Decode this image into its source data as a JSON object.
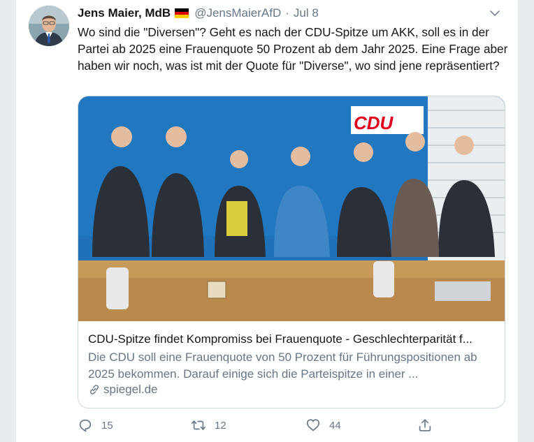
{
  "tweet": {
    "author_name": "Jens Maier, MdB",
    "author_handle": "@JensMaierAfD",
    "separator": "·",
    "date": "Jul 8",
    "flag": "germany-flag",
    "text": "Wo sind die \"Diversen\"? Geht es nach der CDU-Spitze um AKK, soll es in der Partei ab 2025 eine Frauenquote 50 Prozent ab dem Jahr 2025. Eine Frage aber haben wir noch, was ist mit der Quote für \"Diverse\", wo sind jene repräsentiert?"
  },
  "link_card": {
    "image_sign_text": "CDU",
    "title": "CDU-Spitze findet Kompromiss bei Frauenquote - Geschlechterparität f...",
    "description": "Die CDU soll eine Frauenquote von 50 Prozent für Führungspositionen ab 2025 bekommen. Darauf einige sich die Parteispitze in einer ...",
    "domain": "spiegel.de"
  },
  "actions": {
    "reply_count": "15",
    "retweet_count": "12",
    "like_count": "44"
  },
  "icons": {
    "reply": "reply-icon",
    "retweet": "retweet-icon",
    "like": "heart-icon",
    "share": "share-icon",
    "caret": "chevron-down-icon",
    "link": "link-icon"
  },
  "colors": {
    "text_primary": "#14171a",
    "text_secondary": "#657786",
    "border": "#ccd6dd",
    "background_gutter": "#e6ecf0",
    "cdu_red": "#e2001a"
  }
}
